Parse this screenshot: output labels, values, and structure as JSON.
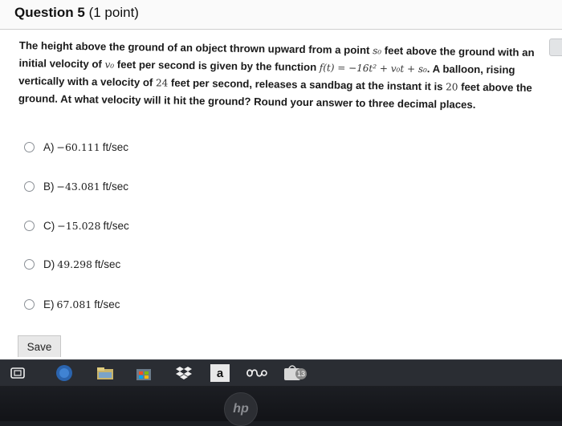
{
  "question": {
    "title": "Question 5",
    "points": "(1 point)",
    "text_1": "The height above the ground of an object thrown upward from a point",
    "var_s0": "s₀",
    "text_2": "feet above the ground with an initial velocity of",
    "var_v0": "v₀",
    "text_3": "feet per second is given by the function",
    "func": "f(t) = −16t² + v₀t + s₀",
    "text_4": ". A balloon, rising vertically with a velocity of",
    "num_24": "24",
    "text_5": "feet per second, releases a sandbag at the instant it is",
    "num_20": "20",
    "text_6": "feet above the ground. At what velocity will it hit the ground? Round your answer to three decimal places."
  },
  "options": [
    {
      "letter": "A)",
      "value": "−60.111",
      "unit": "ft/sec"
    },
    {
      "letter": "B)",
      "value": "−43.081",
      "unit": "ft/sec"
    },
    {
      "letter": "C)",
      "value": "−15.028",
      "unit": "ft/sec"
    },
    {
      "letter": "D)",
      "value": "49.298",
      "unit": "ft/sec"
    },
    {
      "letter": "E)",
      "value": "67.081",
      "unit": "ft/sec"
    }
  ],
  "save_label": "Save",
  "taskbar": {
    "amazon_letter": "a",
    "store_badge": "13"
  },
  "bezel": {
    "logo": "hp"
  }
}
